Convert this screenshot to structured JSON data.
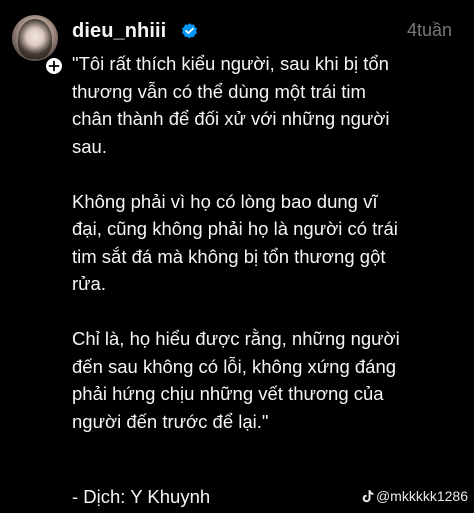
{
  "author": {
    "username": "dieu_nhiii",
    "verified": true
  },
  "post": {
    "time": "4tuần",
    "paragraphs": [
      "\"Tôi rất thích kiểu người, sau khi bị tổn\nthương vẫn có thể dùng một trái tim\nchân thành để đối xử với những người\nsau.",
      "Không phải vì họ có lòng bao dung vĩ\nđại, cũng không phải họ là người có trái\ntim sắt đá mà không bị tổn thương gột\nrửa.",
      "Chỉ là, họ hiểu được rằng, những người\nđến sau không có lỗi, không xứng đáng\nphải hứng chịu những vết thương của\nngười đến trước để lại.\""
    ],
    "credit": "- Dịch: Y Khuynh"
  },
  "watermark": {
    "icon": "tiktok-icon",
    "text": "@mkkkkk1286"
  },
  "colors": {
    "background": "#000000",
    "text": "#f3f5f7",
    "muted": "#777777",
    "verified": "#0095f6"
  }
}
